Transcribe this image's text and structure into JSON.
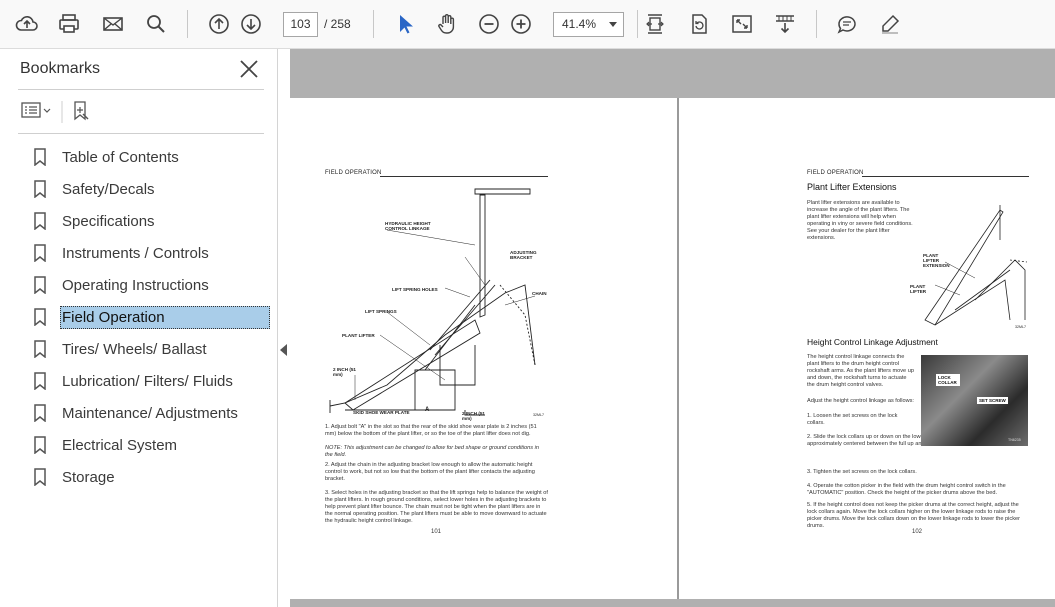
{
  "toolbar": {
    "page_current": "103",
    "page_total": "/  258",
    "zoom": "41.4%",
    "icons": [
      "upload-icon",
      "print-icon",
      "mail-icon",
      "search-icon",
      "page-up-icon",
      "page-down-icon",
      "select-arrow-icon",
      "hand-icon",
      "zoom-out-icon",
      "zoom-in-icon",
      "fit-width-icon",
      "rotate-icon",
      "fullscreen-icon",
      "scroll-icon",
      "comment-icon",
      "pen-icon"
    ]
  },
  "sidebar": {
    "title": "Bookmarks",
    "items": [
      {
        "label": "Table of Contents"
      },
      {
        "label": "Safety/Decals"
      },
      {
        "label": "Specifications"
      },
      {
        "label": "Instruments / Controls"
      },
      {
        "label": "Operating Instructions"
      },
      {
        "label": "Field Operation",
        "selected": true
      },
      {
        "label": "Tires/ Wheels/ Ballast"
      },
      {
        "label": "Lubrication/ Filters/ Fluids"
      },
      {
        "label": "Maintenance/ Adjustments"
      },
      {
        "label": "Electrical System"
      },
      {
        "label": "Storage"
      }
    ]
  },
  "left_page": {
    "header": "FIELD OPERATION",
    "labels": {
      "hyd": "HYDRAULIC HEIGHT CONTROL LINKAGE",
      "adj": "ADJUSTING BRACKET",
      "holes": "LIFT SPRING HOLES",
      "chain": "CHAIN",
      "springs": "LIFT SPRINGS",
      "lifter": "PLANT LIFTER",
      "two_inch_a": "2 INCH (51 mm)",
      "skid": "SKID SHOE WEAR PLATE",
      "a": "A",
      "two_inch_b": "2 INCH (51 mm)",
      "fig": "32ML7"
    },
    "steps": [
      "1.  Adjust bolt \"A\" in the slot so that the rear of the skid shoe wear plate is 2 inches (51 mm) below the bottom of the plant lifter, or so the toe of the plant lifter does not dig.",
      "NOTE: This adjustment can be changed to allow for bed shape or ground conditions in the field.",
      "2.  Adjust the chain in the adjusting bracket low enough to allow the automatic height control to work, but not so low that the bottom of the plant lifter contacts the adjusting bracket.",
      "3.  Select holes in the adjusting bracket so that the lift springs help to balance the weight of the plant lifters. In rough ground conditions, select lower holes in the adjusting brackets to help prevent plant lifter bounce. The chain must not be tight when the plant lifters are in the normal operating position. The plant lifters must be able to move downward to actuate the hydraulic height control linkage."
    ],
    "page_number": "101"
  },
  "right_page": {
    "header": "FIELD OPERATION",
    "section1_title": "Plant Lifter Extensions",
    "section1_body": "Plant lifter extensions are available to increase the angle of the plant lifters. The plant lifter extensions will help when operating in viny or severe field conditions. See your dealer for the plant lifter extensions.",
    "fig1_labels": {
      "ext": "PLANT LIFTER EXTENSION",
      "lifter": "PLANT LIFTER",
      "fig": "32ML7"
    },
    "section2_title": "Height Control Linkage Adjustment",
    "section2_intro": "The height control linkage connects the plant lifters to the drum height control rockshaft arms. As the plant lifters move up and down, the rockshaft turns to actuate the drum height control valves.",
    "section2_lead": "Adjust the height control linkage as follows:",
    "steps": [
      "1.  Loosen the set screws on the lock collars.",
      "2.  Slide the lock collars up or down on the lower linkage rods until the rockshaft arms are approximately centered between the full up and the full down position.",
      "3.  Tighten the set screws on the lock collars.",
      "4.  Operate the cotton picker in the field with the drum height control switch in the \"AUTOMATIC\" position. Check the height of the picker drums above the bed.",
      "5.  If the height control does not keep the picker drums at the correct height, adjust the lock collars again. Move the lock collars higher on the lower linkage rods to raise the picker drums. Move the lock collars down on the lower linkage rods to lower the picker drums."
    ],
    "photo_labels": {
      "lock": "LOCK COLLAR",
      "set": "SET SCREW",
      "fig": "TN6235"
    },
    "page_number": "102"
  }
}
